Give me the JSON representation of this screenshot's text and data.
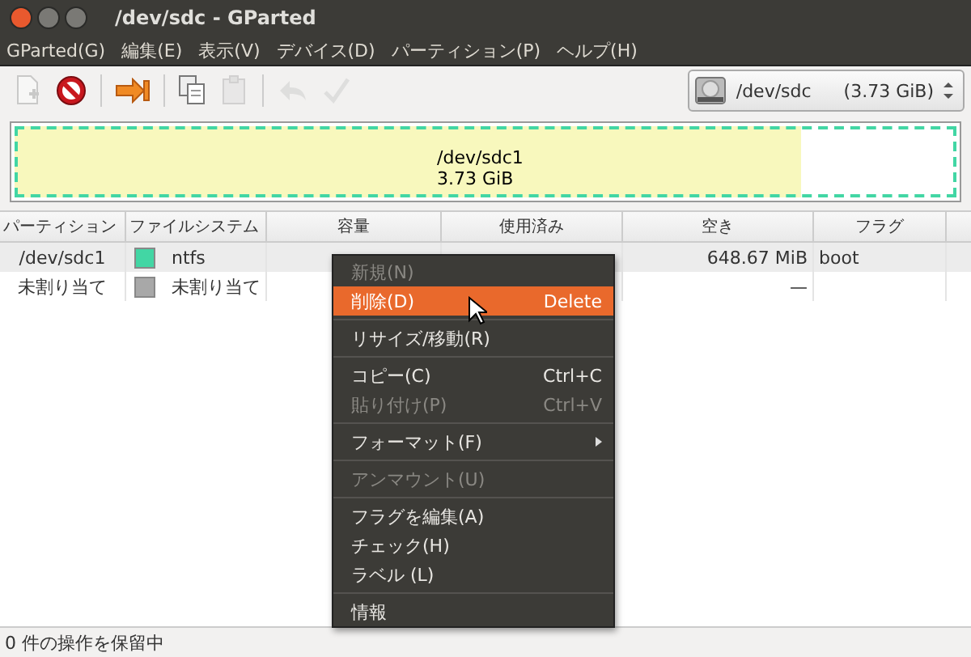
{
  "window": {
    "title": "/dev/sdc - GParted"
  },
  "menubar": [
    "GParted(G)",
    "編集(E)",
    "表示(V)",
    "デバイス(D)",
    "パーティション(P)",
    "ヘルプ(H)"
  ],
  "toolbar": [
    {
      "kind": "new",
      "disabled": true
    },
    {
      "kind": "delete",
      "disabled": false
    },
    {
      "kind": "apply",
      "disabled": false
    },
    {
      "kind": "copy",
      "disabled": false
    },
    {
      "kind": "paste",
      "disabled": true
    },
    {
      "kind": "undo",
      "disabled": true
    },
    {
      "kind": "check",
      "disabled": true
    }
  ],
  "device": {
    "name": "/dev/sdc",
    "size": "(3.73 GiB)"
  },
  "graph": {
    "name": "/dev/sdc1",
    "size": "3.73 GiB",
    "level": 0.83
  },
  "table": {
    "columns": [
      "パーティション",
      "ファイルシステム",
      "容量",
      "使用済み",
      "空き",
      "フラグ"
    ],
    "rows": [
      {
        "partition": "/dev/sdc1",
        "color": "#42d6a4",
        "filesystem": "ntfs",
        "free": "648.67 MiB",
        "flags": "boot",
        "selected": true
      },
      {
        "partition": "未割り当て",
        "color": "#a8a8a8",
        "filesystem": "未割り当て",
        "free": "—",
        "selected": false
      }
    ]
  },
  "context_menu": [
    {
      "label": "新規(N)",
      "disabled": true,
      "selected": false
    },
    {
      "label": "削除(D)",
      "shortcut": "Delete",
      "disabled": false,
      "selected": true
    },
    {
      "kind": "separator"
    },
    {
      "label": "リサイズ/移動(R)",
      "disabled": false,
      "selected": false
    },
    {
      "kind": "separator"
    },
    {
      "label": "コピー(C)",
      "shortcut": "Ctrl+C",
      "disabled": false,
      "selected": false
    },
    {
      "label": "貼り付け(P)",
      "shortcut": "Ctrl+V",
      "disabled": true,
      "selected": false
    },
    {
      "kind": "separator"
    },
    {
      "label": "フォーマット(F)",
      "submenu": true,
      "disabled": false,
      "selected": false
    },
    {
      "kind": "separator"
    },
    {
      "label": "アンマウント(U)",
      "disabled": true,
      "selected": false
    },
    {
      "kind": "separator"
    },
    {
      "label": "フラグを編集(A)",
      "disabled": false,
      "selected": false
    },
    {
      "label": "チェック(H)",
      "disabled": false,
      "selected": false
    },
    {
      "label": "ラベル (L)",
      "disabled": false,
      "selected": false
    },
    {
      "kind": "separator"
    },
    {
      "label": "情報",
      "disabled": false,
      "selected": false
    }
  ],
  "status_bar": "0 件の操作を保留中"
}
